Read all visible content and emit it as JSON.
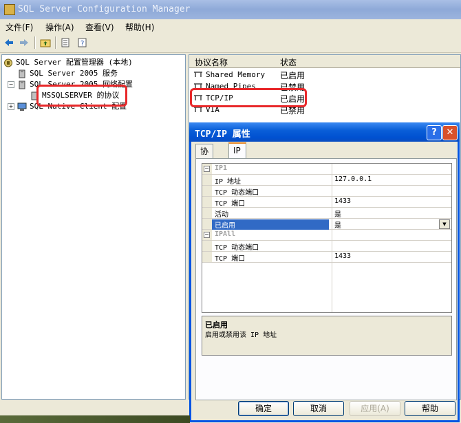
{
  "window": {
    "title": "SQL Server Configuration Manager"
  },
  "menu": {
    "items": [
      "文件(F)",
      "操作(A)",
      "查看(V)",
      "帮助(H)"
    ]
  },
  "tree": {
    "root": "SQL Server 配置管理器 (本地)",
    "services": "SQL Server 2005 服务",
    "network": "SQL Server 2005 网络配置",
    "protocols": "MSSQLSERVER 的协议",
    "native": "SQL Native Client 配置"
  },
  "list": {
    "col_name": "协议名称",
    "col_status": "状态",
    "rows": [
      {
        "name": "Shared Memory",
        "status": "已启用"
      },
      {
        "name": "Named Pipes",
        "status": "已禁用"
      },
      {
        "name": "TCP/IP",
        "status": "已启用"
      },
      {
        "name": "VIA",
        "status": "已禁用"
      }
    ]
  },
  "dialog": {
    "title": "TCP/IP 属性",
    "help_glyph": "?",
    "close_glyph": "✕",
    "tabs": [
      "协议",
      "IP 地址"
    ],
    "grid": {
      "ip1": {
        "category": "IP1",
        "rows": [
          {
            "key": "IP 地址",
            "value": "127.0.0.1"
          },
          {
            "key": "TCP 动态端口",
            "value": ""
          },
          {
            "key": "TCP 端口",
            "value": "1433"
          },
          {
            "key": "活动",
            "value": "是"
          },
          {
            "key": "已启用",
            "value": "是"
          }
        ]
      },
      "ipall": {
        "category": "IPAll",
        "rows": [
          {
            "key": "TCP 动态端口",
            "value": ""
          },
          {
            "key": "TCP 端口",
            "value": "1433"
          }
        ]
      }
    },
    "description": {
      "heading": "已启用",
      "body": "启用或禁用该 IP 地址"
    },
    "buttons": {
      "ok": "确定",
      "cancel": "取消",
      "apply": "应用(A)",
      "help": "帮助"
    }
  },
  "colors": {
    "highlight": "#e8282a",
    "selection": "#316ac5",
    "dialog_title": "#0054e3"
  }
}
